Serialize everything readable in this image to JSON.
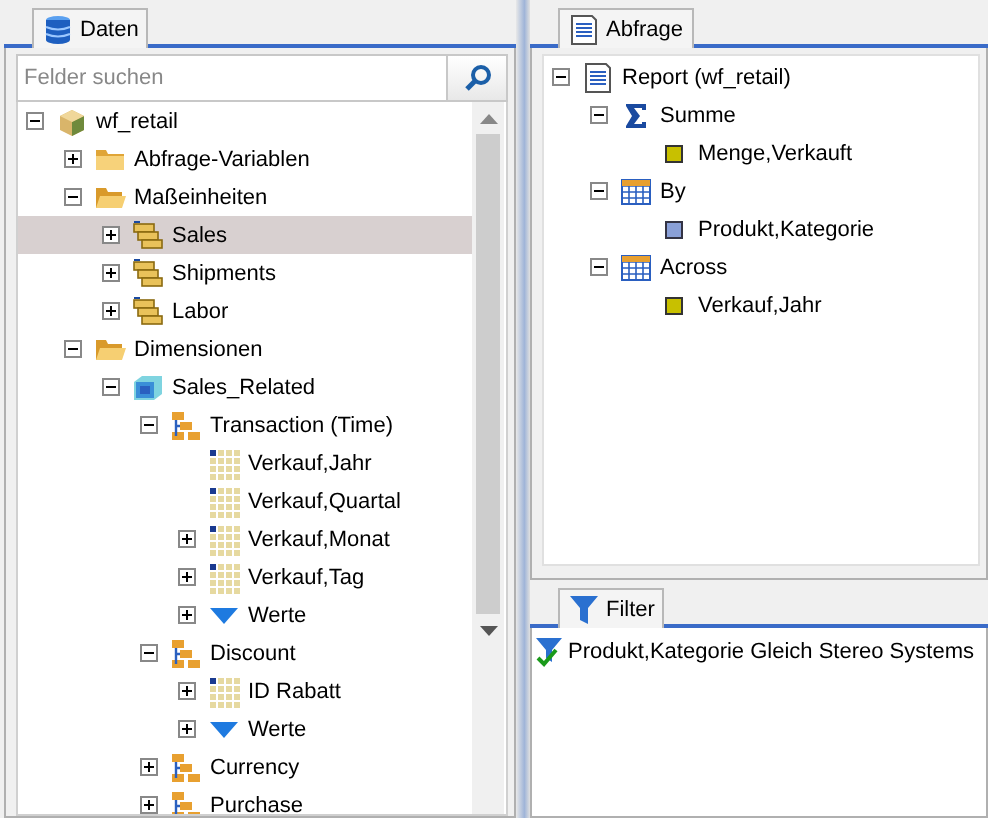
{
  "data_panel": {
    "tab": "Daten",
    "search": {
      "placeholder": "Felder suchen"
    },
    "tree": [
      {
        "label": "wf_retail",
        "kind": "cube",
        "expanded": true,
        "selected": false,
        "children": [
          {
            "label": "Abfrage-Variablen",
            "kind": "folder",
            "expanded": false,
            "selected": false
          },
          {
            "label": "Maßeinheiten",
            "kind": "folder",
            "expanded": true,
            "selected": false,
            "children": [
              {
                "label": "Sales",
                "kind": "measure",
                "expanded": false,
                "selected": true
              },
              {
                "label": "Shipments",
                "kind": "measure",
                "expanded": false,
                "selected": false
              },
              {
                "label": "Labor",
                "kind": "measure",
                "expanded": false,
                "selected": false
              }
            ]
          },
          {
            "label": "Dimensionen",
            "kind": "folder",
            "expanded": true,
            "selected": false,
            "children": [
              {
                "label": "Sales_Related",
                "kind": "dimension",
                "expanded": true,
                "selected": false,
                "children": [
                  {
                    "label": "Transaction (Time)",
                    "kind": "hierarchy",
                    "expanded": true,
                    "selected": false,
                    "children": [
                      {
                        "label": "Verkauf,Jahr",
                        "kind": "field",
                        "selected": false
                      },
                      {
                        "label": "Verkauf,Quartal",
                        "kind": "field",
                        "selected": false
                      },
                      {
                        "label": "Verkauf,Monat",
                        "kind": "field",
                        "expanded": false,
                        "selected": false
                      },
                      {
                        "label": "Verkauf,Tag",
                        "kind": "field",
                        "expanded": false,
                        "selected": false
                      },
                      {
                        "label": "Werte",
                        "kind": "values",
                        "expanded": false,
                        "selected": false
                      }
                    ]
                  },
                  {
                    "label": "Discount",
                    "kind": "hierarchy",
                    "expanded": true,
                    "selected": false,
                    "children": [
                      {
                        "label": "ID Rabatt",
                        "kind": "field",
                        "expanded": false,
                        "selected": false
                      },
                      {
                        "label": "Werte",
                        "kind": "values",
                        "expanded": false,
                        "selected": false
                      }
                    ]
                  },
                  {
                    "label": "Currency",
                    "kind": "hierarchy",
                    "expanded": false,
                    "selected": false
                  },
                  {
                    "label": "Purchase",
                    "kind": "hierarchy",
                    "expanded": false,
                    "selected": false
                  }
                ]
              }
            ]
          }
        ]
      }
    ]
  },
  "query_panel": {
    "tab": "Abfrage",
    "tree": [
      {
        "label": "Report (wf_retail)",
        "kind": "report",
        "expanded": true,
        "children": [
          {
            "label": "Summe",
            "kind": "sum",
            "expanded": true,
            "children": [
              {
                "label": "Menge,Verkauft",
                "kind": "measure-item"
              }
            ]
          },
          {
            "label": "By",
            "kind": "table",
            "expanded": true,
            "children": [
              {
                "label": "Produkt,Kategorie",
                "kind": "dim-item"
              }
            ]
          },
          {
            "label": "Across",
            "kind": "table",
            "expanded": true,
            "children": [
              {
                "label": "Verkauf,Jahr",
                "kind": "measure-item"
              }
            ]
          }
        ]
      }
    ]
  },
  "filter_panel": {
    "tab": "Filter",
    "filters": [
      {
        "label": "Produkt,Kategorie Gleich Stereo Systems",
        "active": true
      }
    ]
  }
}
